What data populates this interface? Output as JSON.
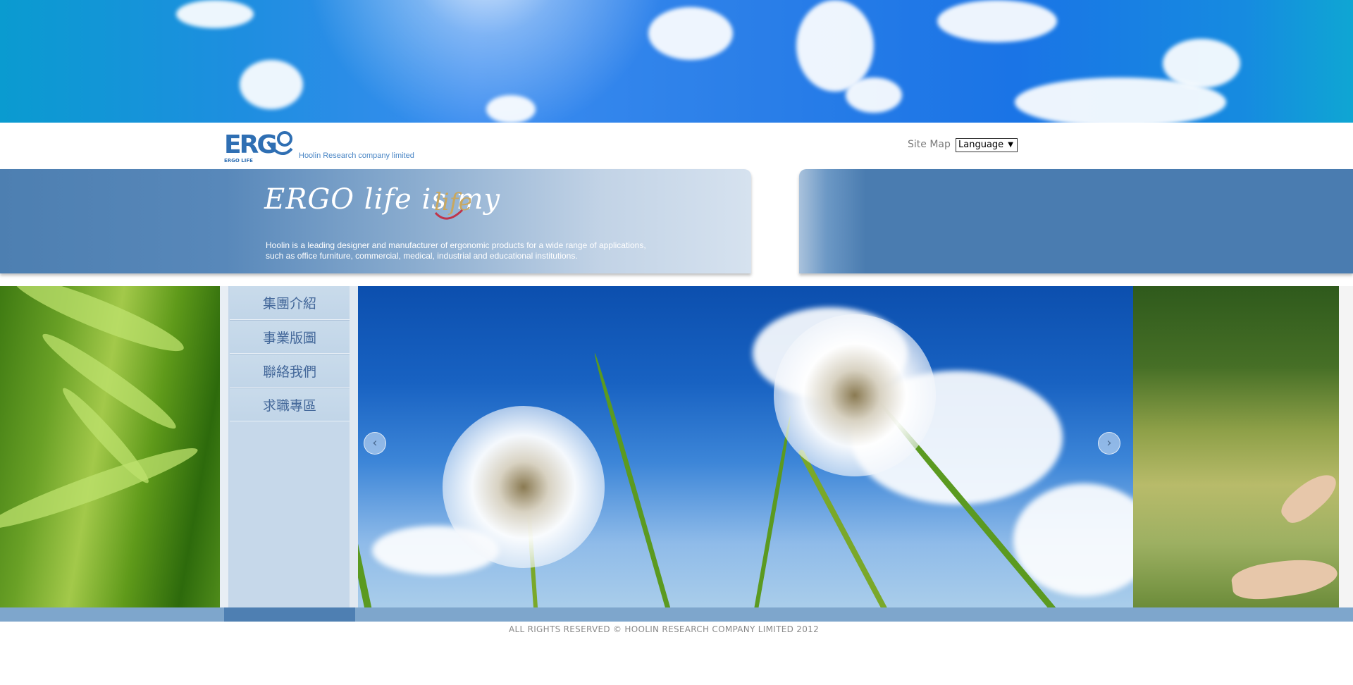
{
  "header": {
    "logo_text": "ERGO LIFE",
    "company_name": "Hoolin Research company limited",
    "site_map_label": "Site Map",
    "language_select": {
      "selected": "Language"
    }
  },
  "banner": {
    "slogan": "ERGO life is my ",
    "slogan_end": "life",
    "tagline_line1": "Hoolin is a leading designer and manufacturer of ergonomic products for a wide range of applications,",
    "tagline_line2": "such as office furniture, commercial, medical, industrial and educational institutions."
  },
  "menu": {
    "items": [
      {
        "label": "集團介紹"
      },
      {
        "label": "事業版圖"
      },
      {
        "label": "聯絡我們"
      },
      {
        "label": "求職專區"
      }
    ]
  },
  "slider": {
    "prev_icon": "chevron-left-icon",
    "next_icon": "chevron-right-icon",
    "prev_glyph": "‹",
    "next_glyph": "›"
  },
  "footer": {
    "copyright": "ALL RIGHTS RESERVED © HOOLIN RESEARCH COMPANY LIMITED 2012"
  },
  "colors": {
    "brand_blue": "#4a7cb0",
    "menu_text": "#44689a",
    "sky_blue": "#1e8ee0"
  }
}
